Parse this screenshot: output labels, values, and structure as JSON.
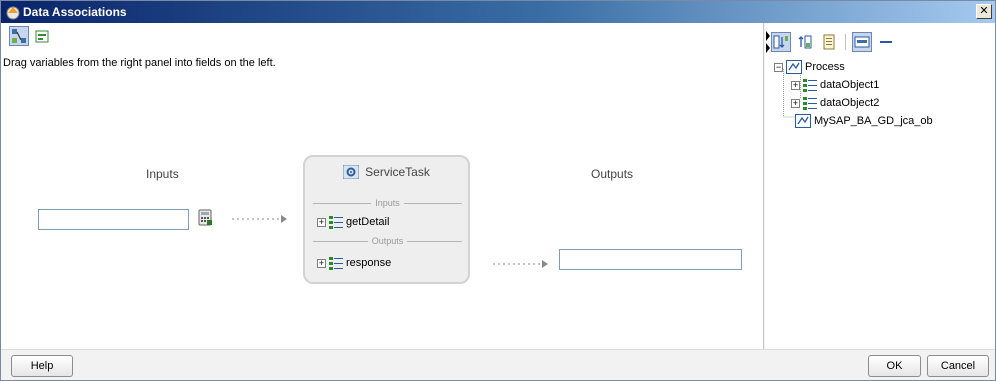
{
  "window": {
    "title": "Data Associations",
    "close_glyph": "✕"
  },
  "hint": "Drag variables from the right panel into fields on the left.",
  "mapping": {
    "inputs_label": "Inputs",
    "outputs_label": "Outputs",
    "input_value": "",
    "output_value": ""
  },
  "task": {
    "name": "ServiceTask",
    "inputs_sep": "Inputs",
    "outputs_sep": "Outputs",
    "input_arg": "getDetail",
    "output_arg": "response"
  },
  "variables_tree": {
    "items": [
      {
        "label": "Process",
        "icon": "process-icon",
        "expand": "−"
      },
      {
        "label": "dataObject1",
        "icon": "data-object-icon",
        "expand": "+"
      },
      {
        "label": "dataObject2",
        "icon": "data-object-icon",
        "expand": "+"
      },
      {
        "label": "MySAP_BA_GD_jca_ob",
        "icon": "process-icon",
        "expand": ""
      }
    ]
  },
  "footer": {
    "help_label": "Help",
    "ok_label": "OK",
    "cancel_label": "Cancel"
  },
  "colors": {
    "title_start": "#0a246a",
    "title_end": "#a6caf0",
    "field_border": "#7f9db9",
    "task_bg": "#eeeeee"
  }
}
